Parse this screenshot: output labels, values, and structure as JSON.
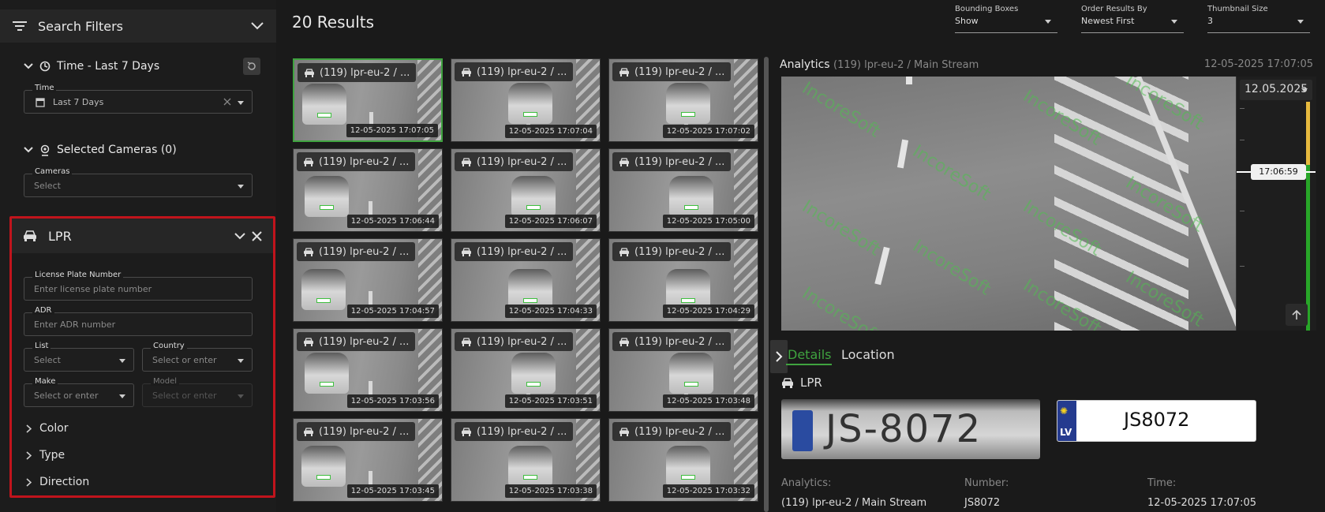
{
  "sidebar": {
    "title": "Search Filters",
    "time_section": "Time - Last 7 Days",
    "time_field": {
      "label": "Time",
      "value": "Last 7 Days"
    },
    "cameras_section": "Selected Cameras (0)",
    "cameras_field": {
      "label": "Cameras",
      "placeholder": "Select"
    },
    "lpr": {
      "title": "LPR",
      "plate": {
        "label": "License Plate Number",
        "placeholder": "Enter license plate number"
      },
      "adr": {
        "label": "ADR",
        "placeholder": "Enter ADR number"
      },
      "list": {
        "label": "List",
        "placeholder": "Select"
      },
      "country": {
        "label": "Country",
        "placeholder": "Select or enter"
      },
      "make": {
        "label": "Make",
        "placeholder": "Select or enter"
      },
      "model": {
        "label": "Model",
        "placeholder": "Select or enter"
      },
      "color": "Color",
      "type": "Type",
      "direction": "Direction"
    }
  },
  "header": {
    "results": "20 Results",
    "bounding": {
      "label": "Bounding Boxes",
      "value": "Show"
    },
    "order": {
      "label": "Order Results By",
      "value": "Newest First"
    },
    "thumb_size": {
      "label": "Thumbnail Size",
      "value": "3"
    }
  },
  "thumbnails": [
    {
      "camera": "(119) lpr-eu-2 / ...",
      "time": "12-05-2025 17:07:05"
    },
    {
      "camera": "(119) lpr-eu-2 / ...",
      "time": "12-05-2025 17:07:04"
    },
    {
      "camera": "(119) lpr-eu-2 / ...",
      "time": "12-05-2025 17:07:02"
    },
    {
      "camera": "(119) lpr-eu-2 / ...",
      "time": "12-05-2025 17:06:44"
    },
    {
      "camera": "(119) lpr-eu-2 / ...",
      "time": "12-05-2025 17:06:07"
    },
    {
      "camera": "(119) lpr-eu-2 / ...",
      "time": "12-05-2025 17:05:00"
    },
    {
      "camera": "(119) lpr-eu-2 / ...",
      "time": "12-05-2025 17:04:57"
    },
    {
      "camera": "(119) lpr-eu-2 / ...",
      "time": "12-05-2025 17:04:33"
    },
    {
      "camera": "(119) lpr-eu-2 / ...",
      "time": "12-05-2025 17:04:29"
    },
    {
      "camera": "(119) lpr-eu-2 / ...",
      "time": "12-05-2025 17:03:56"
    },
    {
      "camera": "(119) lpr-eu-2 / ...",
      "time": "12-05-2025 17:03:51"
    },
    {
      "camera": "(119) lpr-eu-2 / ...",
      "time": "12-05-2025 17:03:48"
    },
    {
      "camera": "(119) lpr-eu-2 / ...",
      "time": "12-05-2025 17:03:45"
    },
    {
      "camera": "(119) lpr-eu-2 / ...",
      "time": "12-05-2025 17:03:38"
    },
    {
      "camera": "(119) lpr-eu-2 / ...",
      "time": "12-05-2025 17:03:32"
    }
  ],
  "analytics": {
    "title": "Analytics",
    "source": "(119) lpr-eu-2 / Main Stream",
    "time": "12-05-2025 17:07:05",
    "watermark": "IncoreSoft",
    "timeline_date": "12.05.2025",
    "timeline_time": "17:06:59",
    "tabs": {
      "details": "Details",
      "location": "Location"
    },
    "lpr_label": "LPR",
    "plate_photo_text": "JS-8072",
    "plate_country": "LV",
    "plate_number": "JS8072",
    "info": {
      "analytics_label": "Analytics:",
      "analytics_value": "(119) lpr-eu-2 / Main Stream",
      "number_label": "Number:",
      "number_value": "JS8072",
      "time_label": "Time:",
      "time_value": "12-05-2025 17:07:05"
    }
  },
  "colors": {
    "accent": "#3fa33f",
    "highlight": "#c0141c",
    "timeline_yellow": "#e6b93e"
  }
}
